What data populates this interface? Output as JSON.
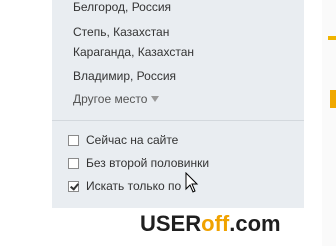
{
  "locations": [
    "Белгород, Россия",
    "Степь, Казахстан",
    "Караганда, Казахстан",
    "Владимир, Россия"
  ],
  "other_place_label": "Другое место",
  "filters": [
    {
      "label": "Сейчас на сайте",
      "checked": false
    },
    {
      "label": "Без второй половинки",
      "checked": false
    },
    {
      "label": "Искать только по",
      "checked": true
    }
  ],
  "watermark": {
    "part1": "USER",
    "part2": "off",
    "part3": ".com"
  }
}
